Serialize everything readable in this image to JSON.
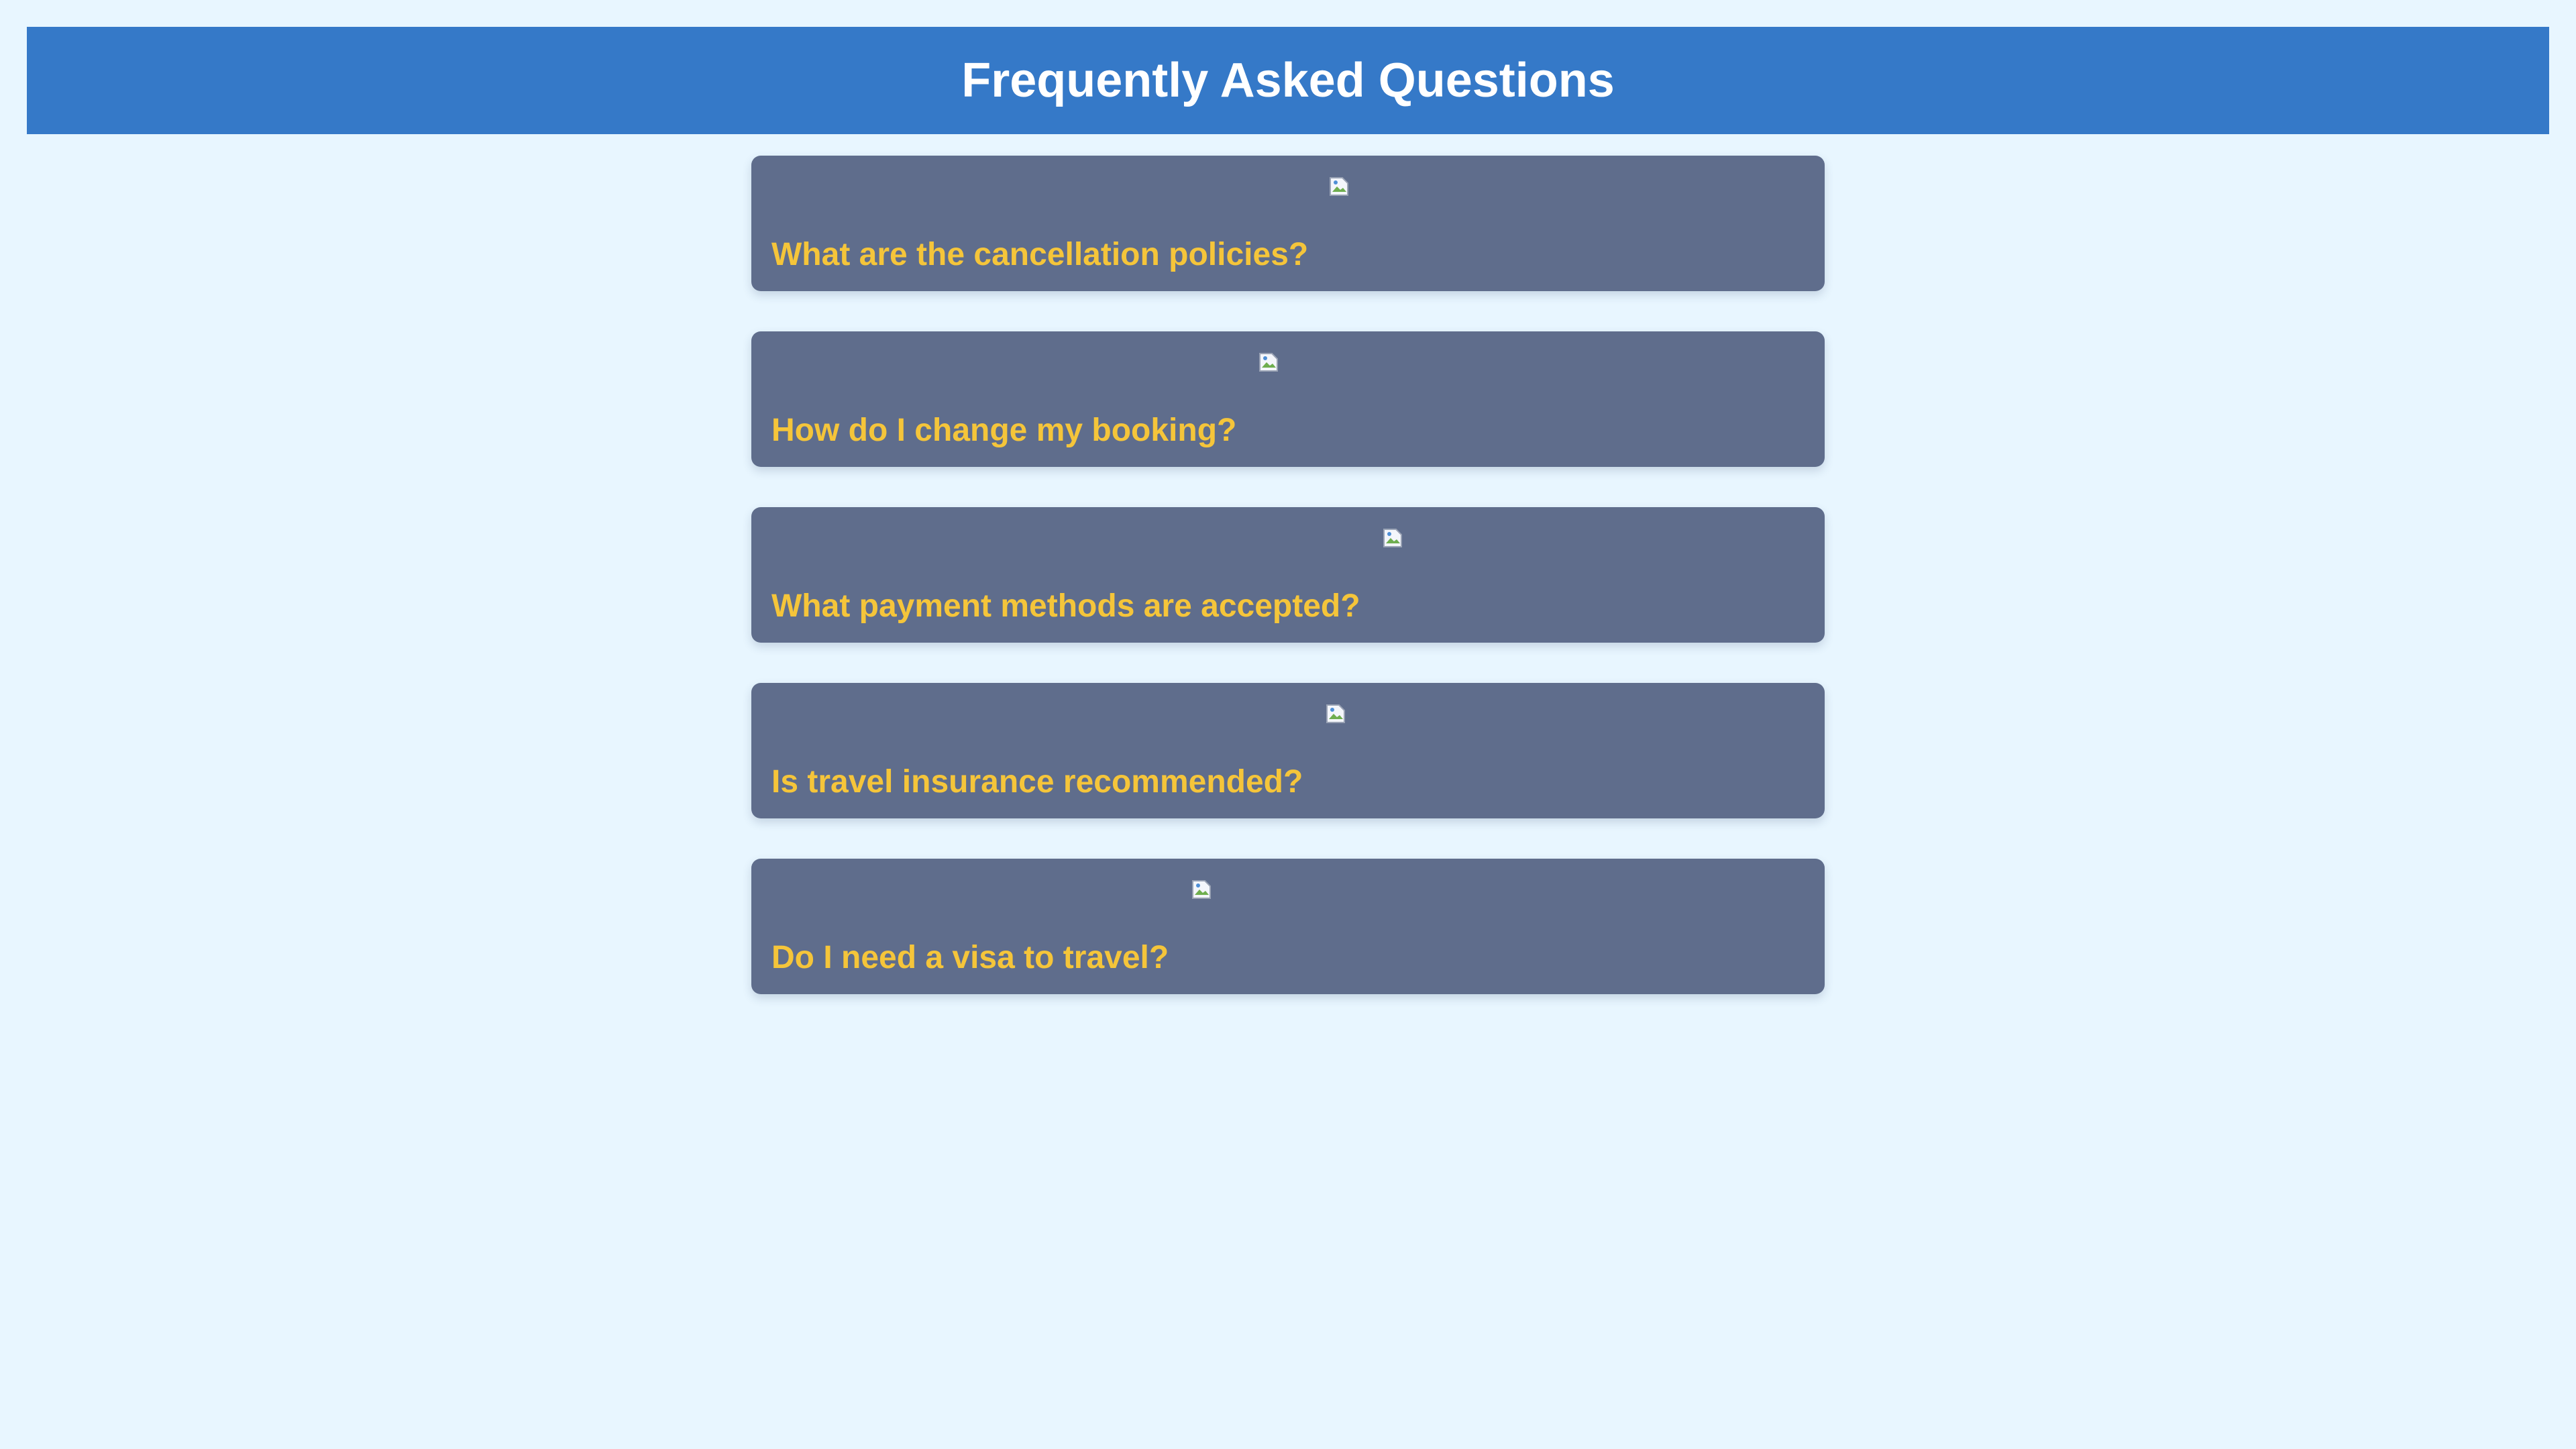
{
  "header": {
    "title": "Frequently Asked Questions"
  },
  "faq": {
    "items": [
      {
        "question": "What are the cancellation policies?",
        "image_icon": "broken-image-icon"
      },
      {
        "question": "How do I change my booking?",
        "image_icon": "broken-image-icon"
      },
      {
        "question": "What payment methods are accepted?",
        "image_icon": "broken-image-icon"
      },
      {
        "question": "Is travel insurance recommended?",
        "image_icon": "broken-image-icon"
      },
      {
        "question": "Do I need a visa to travel?",
        "image_icon": "broken-image-icon"
      }
    ]
  },
  "colors": {
    "background": "#e8f6ff",
    "header_background": "#3579c8",
    "header_text": "#ffffff",
    "card_background": "#5f6d8c",
    "question_text": "#f5c53a"
  }
}
